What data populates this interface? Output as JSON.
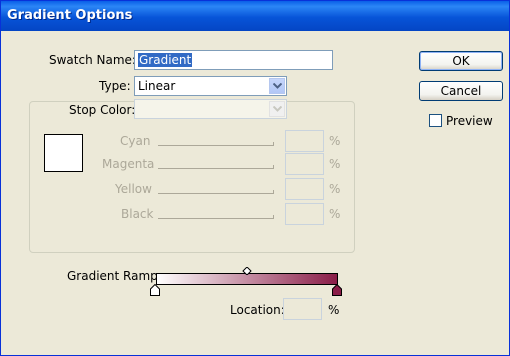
{
  "window": {
    "title": "Gradient Options"
  },
  "form": {
    "swatch_name_label": "Swatch Name:",
    "swatch_name_value": "Gradient",
    "type_label": "Type:",
    "type_value": "Linear",
    "stop_color_label": "Stop Color:",
    "stop_color_value": ""
  },
  "channels": [
    {
      "label": "Cyan",
      "unit": "%"
    },
    {
      "label": "Magenta",
      "unit": "%"
    },
    {
      "label": "Yellow",
      "unit": "%"
    },
    {
      "label": "Black",
      "unit": "%"
    }
  ],
  "ramp": {
    "label": "Gradient Ramp",
    "start_color": "#ffffff",
    "end_color": "#8a1d48",
    "midpoint_percent": 50
  },
  "location": {
    "label": "Location:",
    "value": "",
    "unit": "%"
  },
  "buttons": {
    "ok": "OK",
    "cancel": "Cancel"
  },
  "preview": {
    "label": "Preview",
    "checked": false
  },
  "colors": {
    "title_bar": "#0a5fe8",
    "dialog_bg": "#ece9d8",
    "selection": "#316ac5"
  }
}
